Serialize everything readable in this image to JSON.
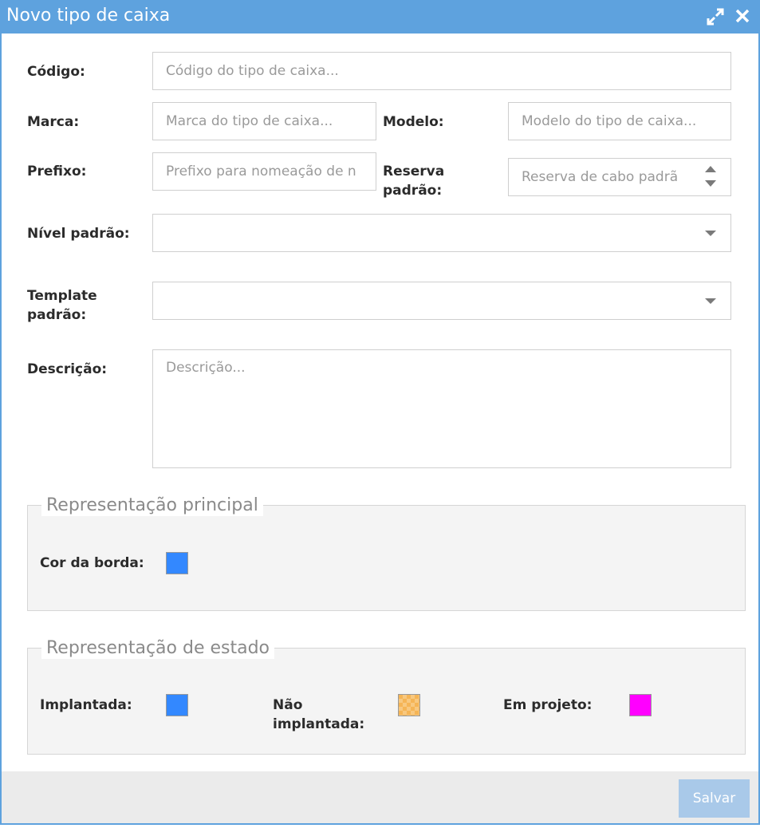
{
  "dialog": {
    "title": "Novo tipo de caixa",
    "icons": {
      "maximize": "expand-arrows-icon",
      "close": "close-x-icon"
    }
  },
  "form": {
    "codigo": {
      "label": "Código:",
      "placeholder": "Código do tipo de caixa..."
    },
    "marca": {
      "label": "Marca:",
      "placeholder": "Marca do tipo de caixa..."
    },
    "modelo": {
      "label": "Modelo:",
      "placeholder": "Modelo do tipo de caixa..."
    },
    "prefixo": {
      "label": "Prefixo:",
      "placeholder": "Prefixo para nomeação de n"
    },
    "reserva": {
      "label_line1": "Reserva",
      "label_line2": "padrão:",
      "placeholder": "Reserva de cabo padrã"
    },
    "nivel": {
      "label": "Nível padrão:",
      "value": ""
    },
    "template": {
      "label_line1": "Template",
      "label_line2": "padrão:",
      "value": ""
    },
    "descricao": {
      "label": "Descrição:",
      "placeholder": "Descrição..."
    }
  },
  "principal": {
    "legend": "Representação principal",
    "cor_borda": {
      "label": "Cor da borda:",
      "color": "#3388ff"
    }
  },
  "estado": {
    "legend": "Representação de estado",
    "implantada": {
      "label": "Implantada:",
      "color": "#3388ff"
    },
    "nao_implantada": {
      "label_line1": "Não",
      "label_line2": "implantada:",
      "color": "#f5b556"
    },
    "em_projeto": {
      "label": "Em projeto:",
      "color": "#ff00ff"
    }
  },
  "footer": {
    "save_label": "Salvar"
  }
}
